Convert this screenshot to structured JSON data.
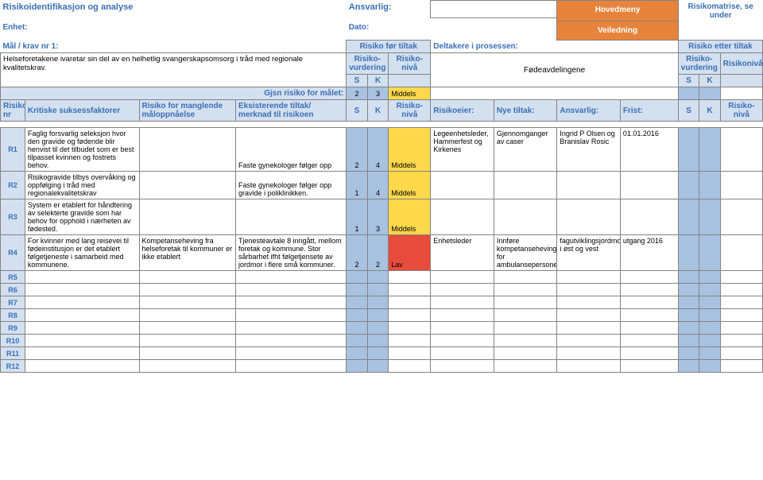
{
  "title": "Risikoidentifikasjon og analyse",
  "ansvarlig_label": "Ansvarlig:",
  "hovedmeny": "Hovedmeny",
  "matrise_label": "Risikomatrise, se under",
  "enhet_label": "Enhet:",
  "dato_label": "Dato:",
  "veiledning": "Veiledning",
  "maal_label": "Mål / krav nr 1:",
  "for_tiltak": "Risiko før tiltak",
  "deltak_label": "Deltakere i prosessen:",
  "etter_tiltak": "Risiko etter tiltak",
  "maal_text": "Helseforetakene ivaretar sin del av en helhetlig svangerskapsomsorg i tråd med regionale kvalitetskrav.",
  "vurdering1": "Risiko-vurdering",
  "nivaa1": "Risiko-nivå",
  "deltakere": "Fødeavdelingene",
  "vurdering2": "Risiko-vurdering",
  "nivaa2": "Risikonivå",
  "s": "S",
  "k": "K",
  "gjsn": "Gjsn risiko for målet:",
  "gjsn_s": "2",
  "gjsn_k": "3",
  "gjsn_n": "Middels",
  "col": {
    "nr": "Risiko nr",
    "krit": "Kritiske suksessfaktorer",
    "mang": "Risiko for manglende måloppnåelse",
    "eks": "Eksisterende tiltak/ merknad til risikoen",
    "s": "S",
    "k": "K",
    "niv": "Risiko-nivå",
    "eier": "Risikoeier:",
    "nye": "Nye tiltak:",
    "ans": "Ansvarlig:",
    "frist": "Frist:",
    "s2": "S",
    "k2": "K",
    "niv2": "Risiko-nivå"
  },
  "rows": [
    {
      "id": "R1",
      "krit": "Faglig forsvarlig seleksjon hvor den gravide og fødende blir henvist til det tilbudet som er best tilpasset kvinnen og fostrets behov.",
      "mang": "",
      "eks": "Faste gynekologer følger opp",
      "s": "2",
      "k": "4",
      "niv": "Middels",
      "niv_class": "yellow-cell",
      "eier": "Legeenhetsleder, Hammerfest og Kirkenes",
      "nye": "Gjennomganger av caser",
      "ans": "Ingrid P Olsen og Branislav Rosic",
      "frist": "01.01.2016"
    },
    {
      "id": "R2",
      "krit": "Risikogravide tilbys overvåking og oppfølging i tråd med regionalekvalitetskrav",
      "mang": "",
      "eks": "Faste gynekologer følger opp gravide i poliklinikken.",
      "s": "1",
      "k": "4",
      "niv": "Middels",
      "niv_class": "yellow-cell",
      "eier": "",
      "nye": "",
      "ans": "",
      "frist": ""
    },
    {
      "id": "R3",
      "krit": "System er etablert for håndtering av selekterte gravide som har behov for opphold i nærheten av fødested.",
      "mang": "",
      "eks": "",
      "s": "1",
      "k": "3",
      "niv": "Middels",
      "niv_class": "yellow-cell",
      "eier": "",
      "nye": "",
      "ans": "",
      "frist": ""
    },
    {
      "id": "R4",
      "krit": "For kvinner med lang reisevei til fødeinstitusjon er det etablert følgetjeneste i samarbeid med kommunene.",
      "mang": "Kompetanseheving fra helseforetak til kommuner er ikke etablert",
      "eks": "Tjenesteavtale 8 inngått, mellom foretak og kommune.  Stor sårbarhet ifht følgetjensete av jordmor i flere små kommuner.",
      "s": "2",
      "k": "2",
      "niv": "Lav",
      "niv_class": "red-cell",
      "eier": "Enhetsleder",
      "nye": "Innføre kompetanseheving/kurs for ambulansepersonell",
      "ans": "fagutviklingsjordmor, i øst og vest",
      "frist": "utgang 2016"
    },
    {
      "id": "R5"
    },
    {
      "id": "R6"
    },
    {
      "id": "R7"
    },
    {
      "id": "R8"
    },
    {
      "id": "R9"
    },
    {
      "id": "R10"
    },
    {
      "id": "R11"
    },
    {
      "id": "R12"
    }
  ]
}
